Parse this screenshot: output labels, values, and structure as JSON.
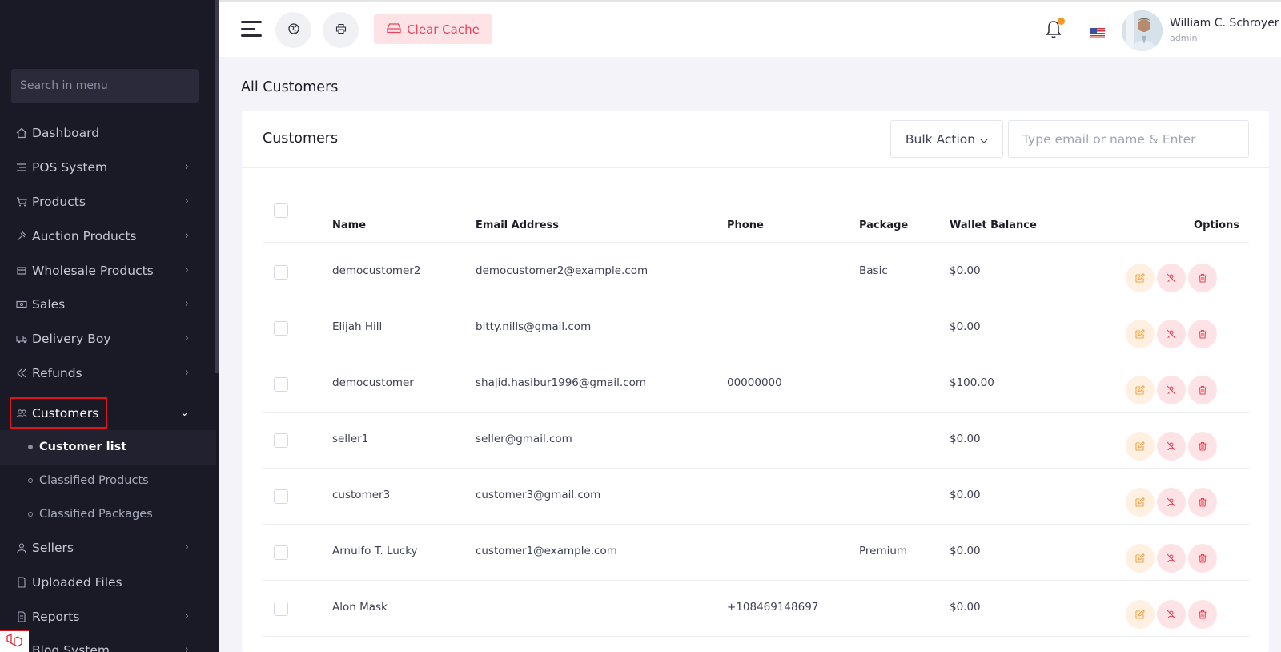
{
  "sidebar": {
    "search_placeholder": "Search in menu",
    "items": [
      {
        "label": "Dashboard",
        "icon": "home-icon"
      },
      {
        "label": "POS System",
        "icon": "list-icon"
      },
      {
        "label": "Products",
        "icon": "cart-icon"
      },
      {
        "label": "Auction Products",
        "icon": "gavel-icon"
      },
      {
        "label": "Wholesale Products",
        "icon": "wholesale-icon"
      },
      {
        "label": "Sales",
        "icon": "money-icon"
      },
      {
        "label": "Delivery Boy",
        "icon": "truck-icon"
      },
      {
        "label": "Refunds",
        "icon": "refund-icon"
      },
      {
        "label": "Customers",
        "icon": "users-icon"
      },
      {
        "label": "Sellers",
        "icon": "user-icon"
      },
      {
        "label": "Uploaded Files",
        "icon": "file-icon"
      },
      {
        "label": "Reports",
        "icon": "report-icon"
      },
      {
        "label": "Blog System",
        "icon": "blog-icon"
      }
    ],
    "customers_submenu": [
      "Customer list",
      "Classified Products",
      "Classified Packages"
    ]
  },
  "topbar": {
    "clear_cache_label": "Clear Cache",
    "user_name": "William C. Schroyer",
    "user_role": "admin"
  },
  "page": {
    "title": "All Customers",
    "card_title": "Customers",
    "bulk_action_label": "Bulk Action",
    "search_placeholder": "Type email or name & Enter"
  },
  "table": {
    "headers": {
      "name": "Name",
      "email": "Email Address",
      "phone": "Phone",
      "package": "Package",
      "wallet": "Wallet Balance",
      "options": "Options"
    },
    "rows": [
      {
        "name": "democustomer2",
        "email": "democustomer2@example.com",
        "phone": "",
        "package": "Basic",
        "wallet": "$0.00"
      },
      {
        "name": "Elijah Hill",
        "email": "bitty.nills@gmail.com",
        "phone": "",
        "package": "",
        "wallet": "$0.00"
      },
      {
        "name": "democustomer",
        "email": "shajid.hasibur1996@gmail.com",
        "phone": "00000000",
        "package": "",
        "wallet": "$100.00"
      },
      {
        "name": "seller1",
        "email": "seller@gmail.com",
        "phone": "",
        "package": "",
        "wallet": "$0.00"
      },
      {
        "name": "customer3",
        "email": "customer3@gmail.com",
        "phone": "",
        "package": "",
        "wallet": "$0.00"
      },
      {
        "name": "Arnulfo T. Lucky",
        "email": "customer1@example.com",
        "phone": "",
        "package": "Premium",
        "wallet": "$0.00"
      },
      {
        "name": "Alon Mask",
        "email": "",
        "phone": "+108469148697",
        "package": "",
        "wallet": "$0.00"
      }
    ]
  },
  "colors": {
    "sidebar_bg": "#1a1a27",
    "accent_pink": "#e8445a",
    "accent_orange": "#f0a44b",
    "highlight_border": "#e0141c"
  }
}
